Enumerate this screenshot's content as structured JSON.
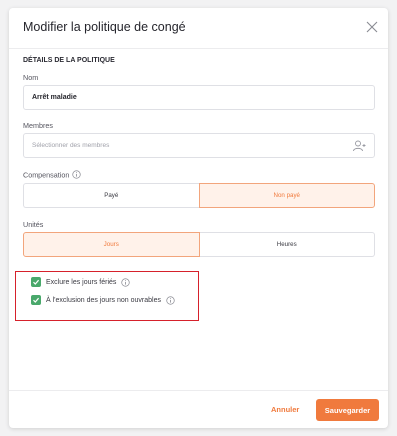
{
  "dialog": {
    "title": "Modifier la politique de congé",
    "section_title": "DÉTAILS DE LA POLITIQUE"
  },
  "name_field": {
    "label": "Nom",
    "value": "Arrêt maladie"
  },
  "members_field": {
    "label": "Membres",
    "placeholder": "Sélectionner des membres"
  },
  "compensation": {
    "label": "Compensation",
    "options": [
      "Payé",
      "Non payé"
    ],
    "selected": "Non payé"
  },
  "units": {
    "label": "Unités",
    "options": [
      "Jours",
      "Heures"
    ],
    "selected": "Jours"
  },
  "checkboxes": [
    {
      "label": "Exclure les jours fériés",
      "checked": true
    },
    {
      "label": "À l'exclusion des jours non ouvrables",
      "checked": true
    }
  ],
  "footer": {
    "cancel_label": "Annuler",
    "save_label": "Sauvegarder"
  },
  "colors": {
    "accent": "#f07a3d",
    "check": "#49a86b",
    "highlight": "#d6212b"
  }
}
